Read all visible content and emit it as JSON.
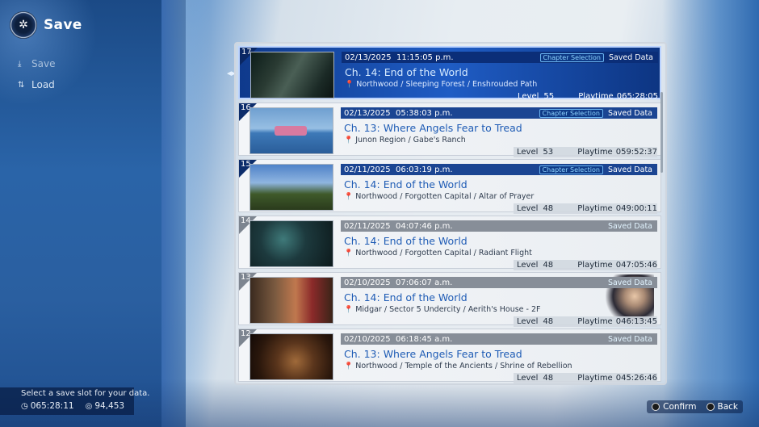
{
  "header": {
    "title": "Save",
    "icon": "menu-gear-icon"
  },
  "menu": [
    {
      "label": "Save",
      "icon": "save-icon"
    },
    {
      "label": "Load",
      "icon": "load-icon"
    }
  ],
  "slots": [
    {
      "num": "17",
      "date": "02/13/2025",
      "time": "11:15:05 p.m.",
      "chapter_chip": "Chapter Selection",
      "saved": "Saved Data",
      "chapter": "Ch. 14: End of the World",
      "location": "Northwood / Sleeping Forest / Enshrouded Path",
      "level_label": "Level",
      "level": "55",
      "playtime_label": "Playtime",
      "playtime": "065:28:05"
    },
    {
      "num": "16",
      "date": "02/13/2025",
      "time": "05:38:03 p.m.",
      "chapter_chip": "Chapter Selection",
      "saved": "Saved Data",
      "chapter": "Ch. 13: Where Angels Fear to Tread",
      "location": "Junon Region / Gabe's Ranch",
      "level_label": "Level",
      "level": "53",
      "playtime_label": "Playtime",
      "playtime": "059:52:37"
    },
    {
      "num": "15",
      "date": "02/11/2025",
      "time": "06:03:19 p.m.",
      "chapter_chip": "Chapter Selection",
      "saved": "Saved Data",
      "chapter": "Ch. 14: End of the World",
      "location": "Northwood / Forgotten Capital / Altar of Prayer",
      "level_label": "Level",
      "level": "48",
      "playtime_label": "Playtime",
      "playtime": "049:00:11"
    },
    {
      "num": "14",
      "date": "02/11/2025",
      "time": "04:07:46 p.m.",
      "chapter_chip": "",
      "saved": "Saved Data",
      "chapter": "Ch. 14: End of the World",
      "location": "Northwood / Forgotten Capital / Radiant Flight",
      "level_label": "Level",
      "level": "48",
      "playtime_label": "Playtime",
      "playtime": "047:05:46"
    },
    {
      "num": "13",
      "date": "02/10/2025",
      "time": "07:06:07 a.m.",
      "chapter_chip": "",
      "saved": "Saved Data",
      "chapter": "Ch. 14: End of the World",
      "location": "Midgar / Sector 5 Undercity / Aerith's House - 2F",
      "level_label": "Level",
      "level": "48",
      "playtime_label": "Playtime",
      "playtime": "046:13:45"
    },
    {
      "num": "12",
      "date": "02/10/2025",
      "time": "06:18:45 a.m.",
      "chapter_chip": "",
      "saved": "Saved Data",
      "chapter": "Ch. 13: Where Angels Fear to Tread",
      "location": "Northwood / Temple of the Ancients / Shrine of Rebellion",
      "level_label": "Level",
      "level": "48",
      "playtime_label": "Playtime",
      "playtime": "045:26:46"
    }
  ],
  "footer": {
    "message": "Select a save slot for your data.",
    "playtime": "065:28:11",
    "gil": "94,453"
  },
  "controls": {
    "confirm": "Confirm",
    "back": "Back"
  }
}
